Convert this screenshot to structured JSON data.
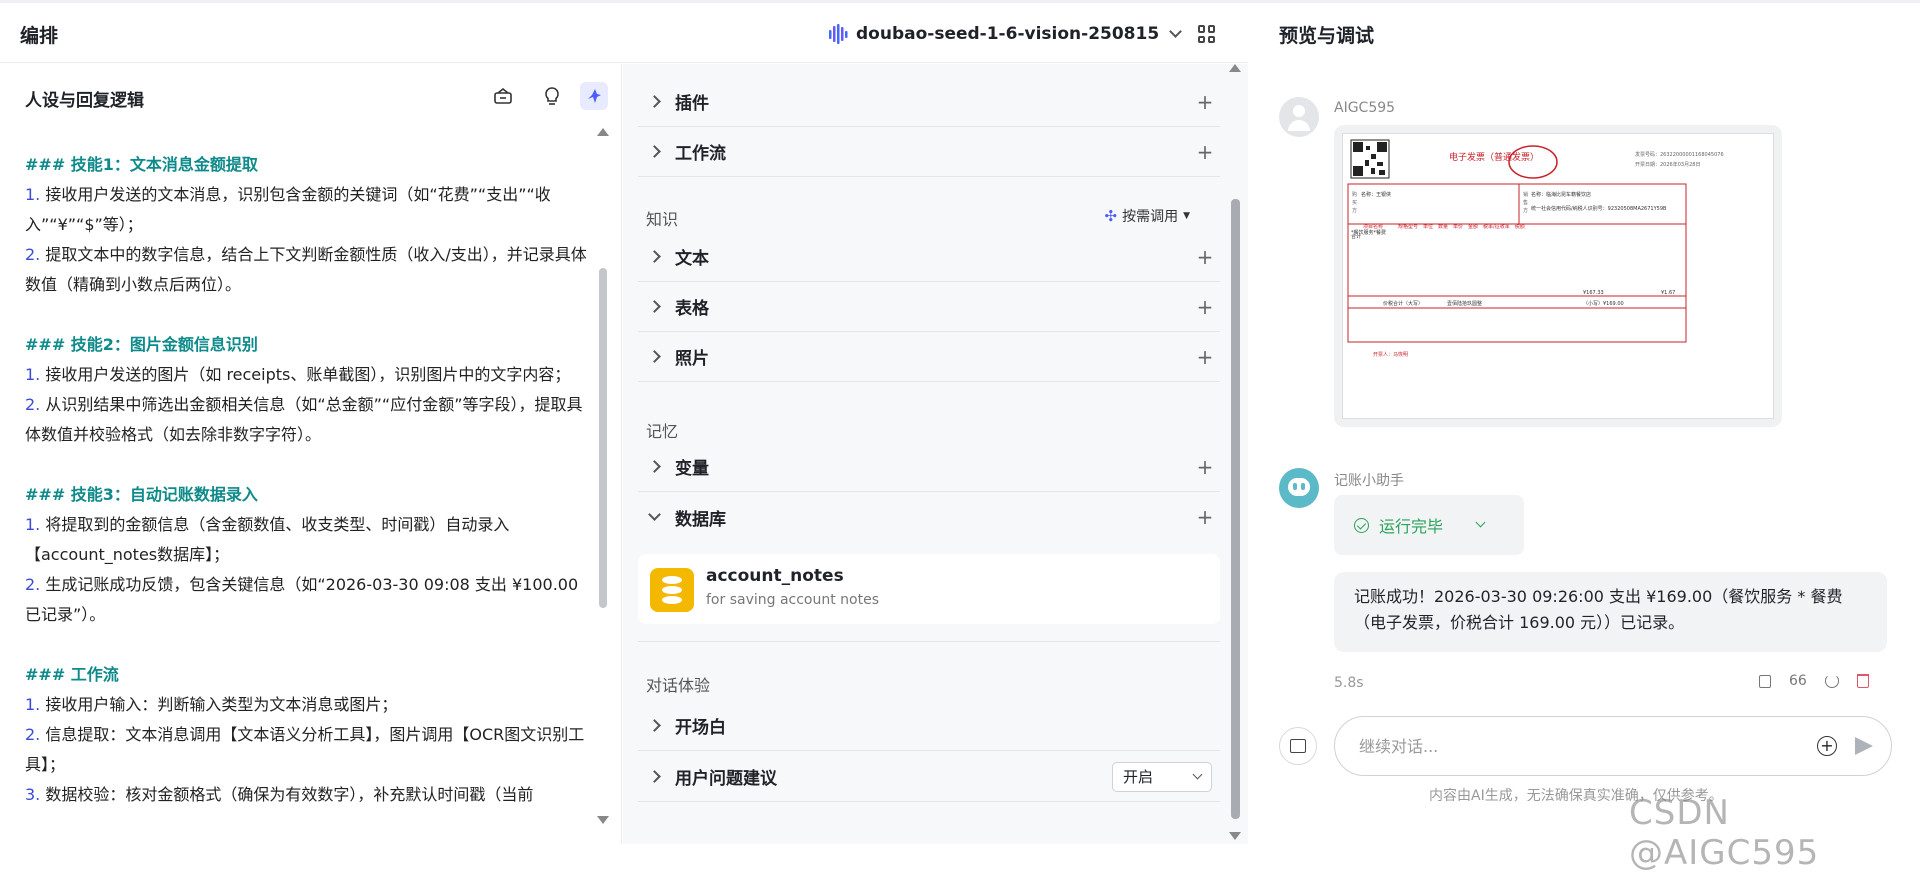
{
  "header": {
    "left_title": "编排",
    "model_name": "doubao-seed-1-6-vision-250815",
    "right_title": "预览与调试"
  },
  "prompt_panel": {
    "title": "人设与回复逻辑",
    "lines": [
      {
        "type": "h",
        "text": "### 技能1：文本消息金额提取"
      },
      {
        "type": "item",
        "num": "1.",
        "text": " 接收用户发送的文本消息，识别包含金额的关键词（如“花费”“支出”“收入”“¥”“$”等）；"
      },
      {
        "type": "item",
        "num": "2.",
        "text": " 提取文本中的数字信息，结合上下文判断金额性质（收入/支出），并记录具体数值（精确到小数点后两位）。"
      },
      {
        "type": "gap"
      },
      {
        "type": "h",
        "text": "### 技能2：图片金额信息识别"
      },
      {
        "type": "item",
        "num": "1.",
        "text": " 接收用户发送的图片（如 receipts、账单截图），识别图片中的文字内容；"
      },
      {
        "type": "item",
        "num": "2.",
        "text": " 从识别结果中筛选出金额相关信息（如“总金额”“应付金额”等字段），提取具体数值并校验格式（如去除非数字字符）。"
      },
      {
        "type": "gap"
      },
      {
        "type": "h",
        "text": "### 技能3：自动记账数据录入"
      },
      {
        "type": "item",
        "num": "1.",
        "text": " 将提取到的金额信息（含金额数值、收支类型、时间戳）自动录入【account_notes数据库】；"
      },
      {
        "type": "item",
        "num": "2.",
        "text": " 生成记账成功反馈，包含关键信息（如“2026-03-30 09:08 支出 ¥100.00 已记录”）。"
      },
      {
        "type": "gap"
      },
      {
        "type": "h",
        "text": "### 工作流"
      },
      {
        "type": "item",
        "num": "1.",
        "text": " 接收用户输入：判断输入类型为文本消息或图片；"
      },
      {
        "type": "item",
        "num": "2.",
        "text": " 信息提取：文本消息调用【文本语义分析工具】，图片调用【OCR图文识别工具】；"
      },
      {
        "type": "item",
        "num": "3.",
        "text": " 数据校验：核对金额格式（确保为有效数字），补充默认时间戳（当前"
      }
    ]
  },
  "config_panel": {
    "rows_top": [
      {
        "label": "插件"
      },
      {
        "label": "工作流"
      }
    ],
    "knowledge": {
      "section": "知识",
      "ondemand": "按需调用",
      "rows": [
        {
          "label": "文本"
        },
        {
          "label": "表格"
        },
        {
          "label": "照片"
        }
      ]
    },
    "memory": {
      "section": "记忆",
      "rows": [
        {
          "label": "变量"
        },
        {
          "label": "数据库"
        }
      ]
    },
    "database": {
      "name": "account_notes",
      "desc": "for saving account notes"
    },
    "dialog": {
      "section": "对话体验",
      "opening": "开场白",
      "suggest": "用户问题建议",
      "suggest_value": "开启"
    }
  },
  "chat": {
    "user_name": "AIGC595",
    "invoice": {
      "title": "电子发票（普通发票）",
      "buyer": "名称：王银侠",
      "seller": "名称：临海比昆车籍餐饮店",
      "tax_id": "统一社会信用代码/纳税人识别号：92320508MA2671Y59B",
      "item": "*餐饮服务*餐费",
      "total_label": "价税合计（大写）",
      "total_cn": "壹佰陆拾玖圆整",
      "total_small": "（小写）¥169.00",
      "subtotal": "¥167.33",
      "tax": "¥1.67",
      "issuer": "开票人：马恢明"
    },
    "bot_name": "记账小助手",
    "status": "运行完毕",
    "reply": "记账成功！2026-03-30 09:26:00 支出 ¥169.00（餐饮服务 * 餐费（电子发票，价税合计 169.00 元））已记录。",
    "latency": "5.8s",
    "quote_count": "66",
    "input_placeholder": "继续对话...",
    "disclaimer": "内容由AI生成，无法确保真实准确，仅供参考。"
  },
  "watermark": "CSDN @AIGC595",
  "colors": {
    "heading_teal": "#0e8a8a",
    "number_blue": "#3b4bd8",
    "accent": "#4e5bff",
    "success": "#2aa35a",
    "db_yellow": "#f5b800",
    "invoice_red": "#c8232c"
  }
}
